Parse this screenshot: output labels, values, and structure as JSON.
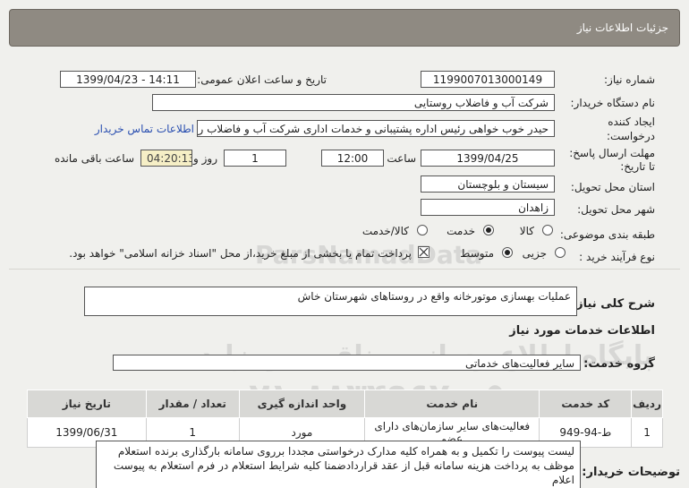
{
  "header": {
    "title": "جزئیات اطلاعات نیاز"
  },
  "fields": {
    "need_number_label": "شماره نیاز:",
    "need_number": "1199007013000149",
    "announce_label": "تاریخ و ساعت اعلان عمومی:",
    "announce_value": "1399/04/23 - 14:11",
    "buyer_label": "نام دستگاه خریدار:",
    "buyer_value": "شرکت آب و فاضلاب روستایی",
    "creator_label_1": "ایجاد کننده",
    "creator_label_2": "درخواست:",
    "creator_value": "حیدر خوب خواهی  رئیس اداره پشتیبانی و خدمات اداری  شرکت آب و فاضلاب روستایی",
    "contact_link": "اطلاعات تماس خریدار",
    "deadline_label_1": "مهلت ارسال پاسخ:",
    "deadline_label_2": "تا تاریخ:",
    "deadline_date": "1399/04/25",
    "time_label": "ساعت",
    "deadline_time": "12:00",
    "day_count": "1",
    "day_label": "روز و",
    "remaining_time": "04:20:13",
    "remaining_label": "ساعت باقی مانده",
    "province_label": "استان محل تحویل:",
    "province_value": "سیستان و بلوچستان",
    "city_label": "شهر محل تحویل:",
    "city_value": "زاهدان",
    "category_label": "طبقه بندی موضوعی:",
    "category_options": [
      "کالا",
      "خدمت",
      "کالا/خدمت"
    ],
    "category_selected": 1,
    "process_label": "نوع فرآیند خرید :",
    "process_options": [
      "جزیی",
      "متوسط"
    ],
    "process_selected": 1,
    "payment_note": "پرداخت تمام یا بخشی از مبلغ خرید،از محل \"اسناد خزانه اسلامی\" خواهد بود.",
    "payment_checked": true,
    "summary_label": "شرح کلی نیاز:",
    "summary_value": "عملیات بهسازی موتورخانه واقع در روستاهای شهرستان خاش"
  },
  "services": {
    "section_title": "اطلاعات خدمات مورد نیاز",
    "group_label": "گروه خدمت:",
    "group_value": "سایر فعالیت‌های خدماتی",
    "columns": [
      "ردیف",
      "کد خدمت",
      "نام خدمت",
      "واحد اندازه گیری",
      "تعداد / مقدار",
      "تاریخ نیاز"
    ],
    "rows": [
      [
        "1",
        "ط-94-949",
        "فعالیت‌های سایر سازمان‌های دارای عضو",
        "مورد",
        "1",
        "1399/06/31"
      ]
    ]
  },
  "buyer_notes": {
    "label": "توضیحات خریدار:",
    "text": "لیست پیوست را تکمیل و به همراه کلیه مدارک درخواستی مجددا برروی سامانه بارگذاری برنده استعلام موظف به پرداخت هزینه سامانه قبل از عقد قراردادضمنا کلیه شرایط استعلام در فرم استعلام به پیوست اعلام"
  },
  "watermark": {
    "brand": "ParsNamadData",
    "line1": "مرکز فراوری اطلاعات پارس نماد داده",
    "line2": "پایگاه اطلاع رسانی مناقصه ومزایده",
    "phone": "۰۲۱-۸۸۳۴۹۶۷۰-۵"
  }
}
